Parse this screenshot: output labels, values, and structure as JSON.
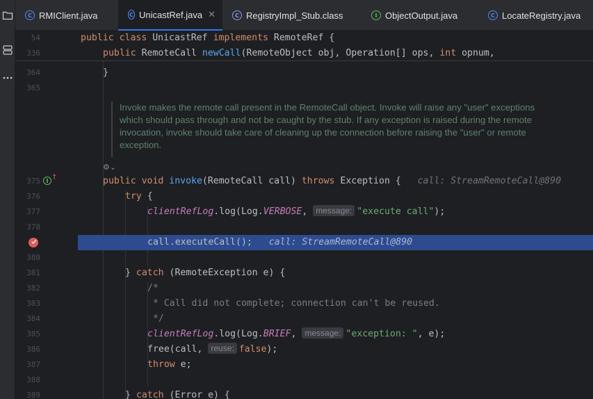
{
  "tabs": [
    {
      "label": "RMIClient.java",
      "icon": "C",
      "active": false
    },
    {
      "label": "UnicastRef.java",
      "icon": "C",
      "active": true
    },
    {
      "label": "RegistryImpl_Stub.class",
      "icon": "C",
      "active": false
    },
    {
      "label": "ObjectOutput.java",
      "icon": "I",
      "active": false
    },
    {
      "label": "LocateRegistry.java",
      "icon": "C",
      "active": false
    }
  ],
  "close_glyph": "✕",
  "sticky": {
    "lines": [
      "54",
      "336"
    ],
    "class_kw1": "public class ",
    "class_name": "UnicastRef ",
    "class_kw2": "implements ",
    "class_iface": "RemoteRef {",
    "m_kw": "public ",
    "m_type": "RemoteCall ",
    "m_name": "newCall",
    "m_args1": "(RemoteObject obj, Operation[] ops, ",
    "m_int": "int",
    "m_args2": " opnum,"
  },
  "lines": {
    "n364": "364",
    "n365": "365",
    "n375": "375",
    "n376": "376",
    "n377": "377",
    "n378": "378",
    "n379": "",
    "n380": "380",
    "n381": "381",
    "n382": "382",
    "n383": "383",
    "n384": "384",
    "n385": "385",
    "n386": "386",
    "n387": "387",
    "n388": "388",
    "n389": "389"
  },
  "code": {
    "l364": "}",
    "doc": "Invoke makes the remote call present in the RemoteCall object. Invoke will raise any \"user\" exceptions which should pass through and not be caught by the stub. If any exception is raised during the remote invocation, invoke should take care of cleaning up the connection before raising the \"user\" or remote exception.",
    "l375_kw": "public void ",
    "l375_fn": "invoke",
    "l375_args": "(RemoteCall call) ",
    "l375_kw2": "throws ",
    "l375_ex": "Exception {",
    "l375_hint": "call: StreamRemoteCall@890",
    "l376_kw": "try",
    "l376_rest": " {",
    "l377_fld": "clientRefLog",
    "l377_a": ".log(Log.",
    "l377_c": "VERBOSE",
    "l377_b": ", ",
    "l377_tag": "message:",
    "l377_str": "\"execute call\"",
    "l377_end": ");",
    "l379_code": "call.executeCall();",
    "l379_hint": "call: StreamRemoteCall@890",
    "l381_a": "} ",
    "l381_kw": "catch",
    "l381_b": " (RemoteException e) {",
    "l382": "/*",
    "l383": " * Call did not complete; connection can't be reused.",
    "l384": " */",
    "l385_fld": "clientRefLog",
    "l385_a": ".log(Log.",
    "l385_c": "BRIEF",
    "l385_b": ", ",
    "l385_tag": "message:",
    "l385_str": "\"exception: \"",
    "l385_end": ", e);",
    "l386_a": "free(call, ",
    "l386_tag": "reuse:",
    "l386_kw": "false",
    "l386_end": ");",
    "l387_kw": "throw",
    "l387_rest": " e;",
    "l389_a": "} ",
    "l389_kw": "catch",
    "l389_b": " (Error e) {"
  },
  "icons": {
    "folder": "folder-icon",
    "structure": "structure-icon",
    "more": "more-icon",
    "render_toggle": "render-docs-icon"
  },
  "colors": {
    "accent": "#3574f0",
    "highlight": "#2d4c8f",
    "breakpoint": "#db5c5c",
    "doc_text": "#5f826b"
  }
}
